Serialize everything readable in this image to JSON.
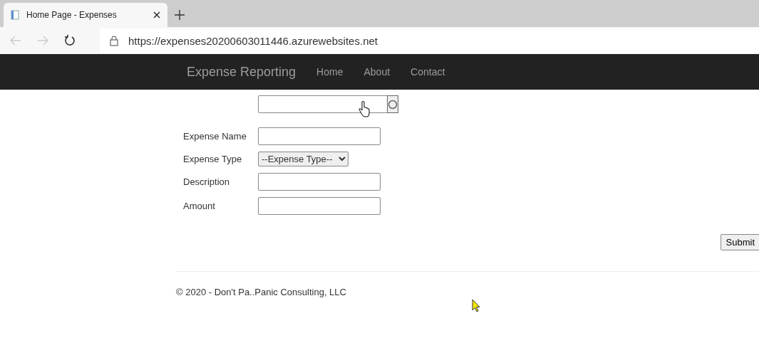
{
  "browser": {
    "tab": {
      "title": "Home Page - Expenses"
    },
    "url": "https://expenses20200603011446.azurewebsites.net"
  },
  "navbar": {
    "brand": "Expense Reporting",
    "links": [
      {
        "label": "Home"
      },
      {
        "label": "About"
      },
      {
        "label": "Contact"
      }
    ]
  },
  "form": {
    "fields": [
      {
        "kind": "text",
        "label": "Expense Name"
      },
      {
        "kind": "select",
        "label": "Expense Type",
        "value": "--Expense Type--"
      },
      {
        "kind": "text",
        "label": "Description"
      },
      {
        "kind": "text",
        "label": "Amount"
      }
    ],
    "submit": "Submit"
  },
  "footer": "© 2020 - Don't Pa..Panic Consulting, LLC"
}
